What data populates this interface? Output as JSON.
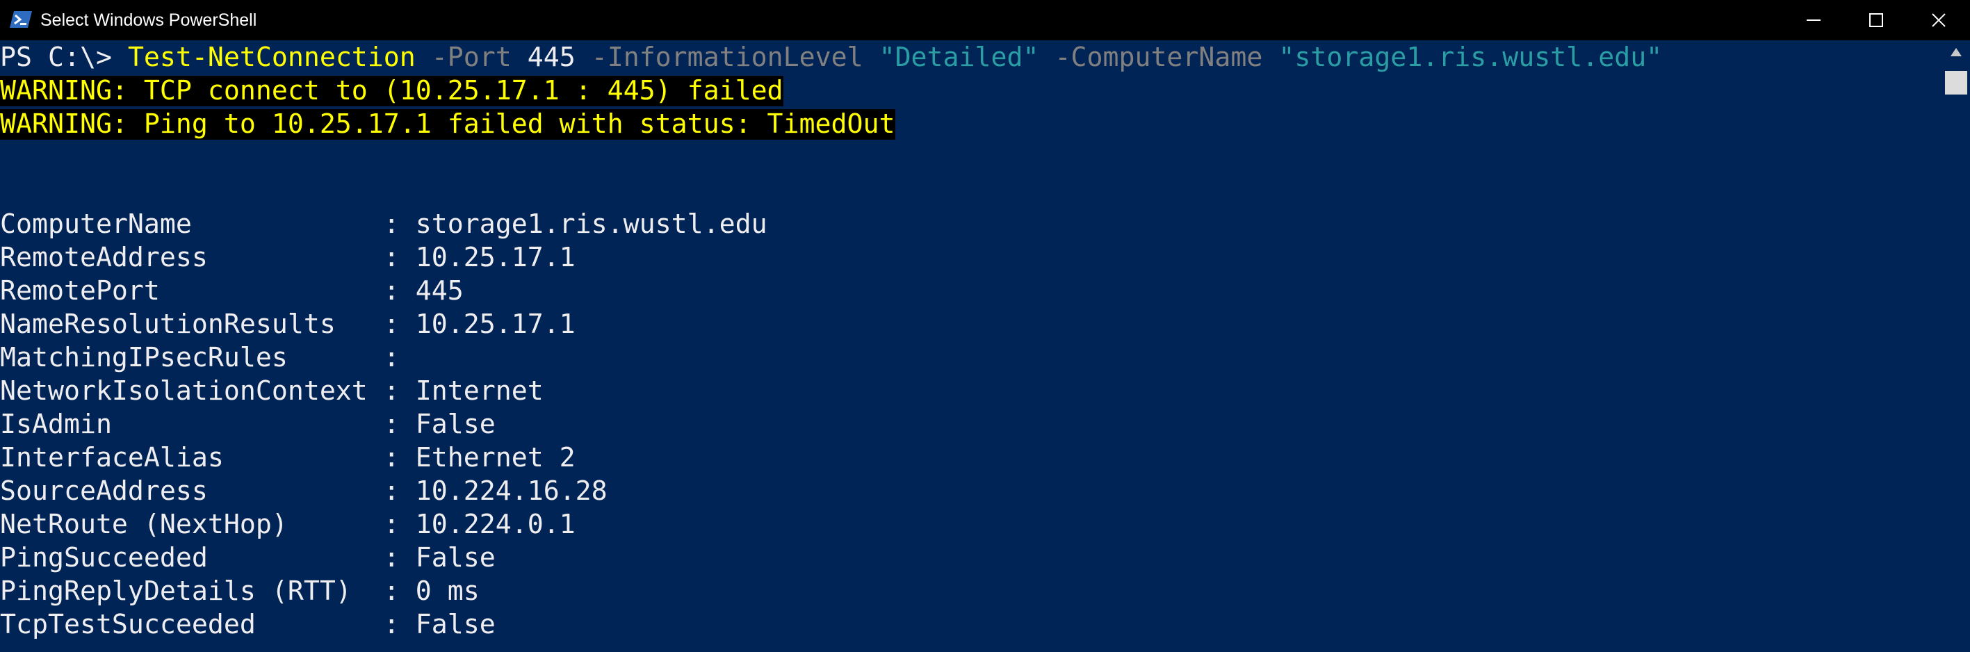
{
  "window": {
    "title": "Select Windows PowerShell",
    "icon": "powershell-icon",
    "controls": {
      "minimize": "minimize-icon",
      "maximize": "maximize-icon",
      "close": "close-icon"
    }
  },
  "colors": {
    "background": "#012456",
    "titlebar": "#000000",
    "foreground": "#eeedf0",
    "command": "#ffff00",
    "parameter": "#808080",
    "string": "#2a9ea4",
    "warning_fg": "#ffff00",
    "warning_bg": "#000000"
  },
  "console": {
    "prompt": "PS C:\\> ",
    "command": {
      "cmdlet": "Test-NetConnection",
      "sp1": " ",
      "param_port": "-Port",
      "port_value": " 445 ",
      "param_info": "-InformationLevel",
      "sp2": " ",
      "info_value": "\"Detailed\"",
      "sp3": " ",
      "param_computer": "-ComputerName",
      "sp4": " ",
      "computer_value": "\"storage1.ris.wustl.edu\""
    },
    "warnings": [
      "WARNING: TCP connect to (10.25.17.1 : 445) failed",
      "WARNING: Ping to 10.25.17.1 failed with status: TimedOut"
    ],
    "results": [
      {
        "key": "ComputerName            ",
        "value": ": storage1.ris.wustl.edu"
      },
      {
        "key": "RemoteAddress           ",
        "value": ": 10.25.17.1"
      },
      {
        "key": "RemotePort              ",
        "value": ": 445"
      },
      {
        "key": "NameResolutionResults   ",
        "value": ": 10.25.17.1"
      },
      {
        "key": "MatchingIPsecRules      ",
        "value": ":"
      },
      {
        "key": "NetworkIsolationContext ",
        "value": ": Internet"
      },
      {
        "key": "IsAdmin                 ",
        "value": ": False"
      },
      {
        "key": "InterfaceAlias          ",
        "value": ": Ethernet 2"
      },
      {
        "key": "SourceAddress           ",
        "value": ": 10.224.16.28"
      },
      {
        "key": "NetRoute (NextHop)      ",
        "value": ": 10.224.0.1"
      },
      {
        "key": "PingSucceeded           ",
        "value": ": False"
      },
      {
        "key": "PingReplyDetails (RTT)  ",
        "value": ": 0 ms"
      },
      {
        "key": "TcpTestSucceeded        ",
        "value": ": False"
      }
    ]
  },
  "scrollbar": {
    "up_icon": "scroll-up-arrow-icon"
  }
}
